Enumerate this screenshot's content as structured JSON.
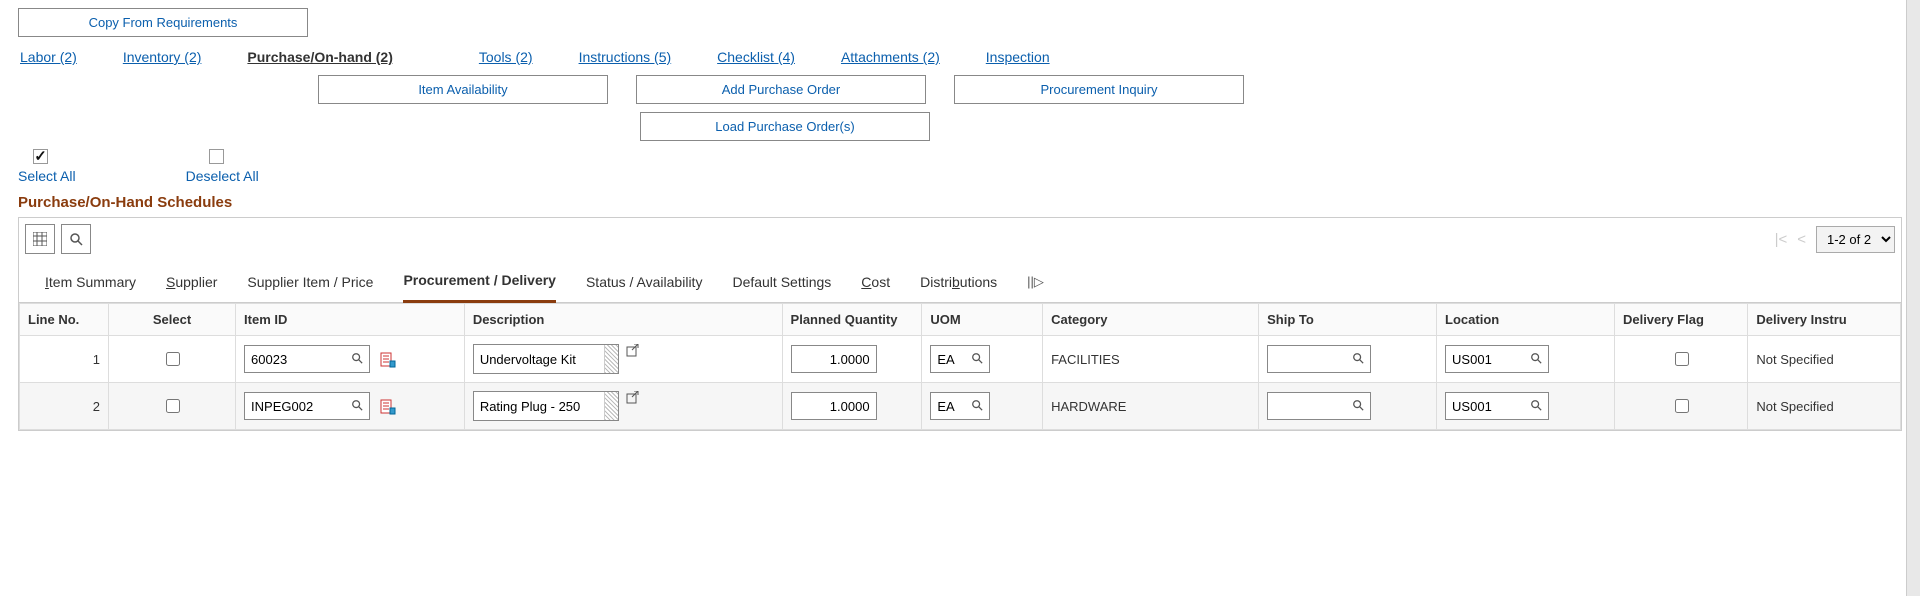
{
  "buttons": {
    "copy_from_requirements": "Copy From Requirements",
    "item_availability": "Item Availability",
    "add_purchase_order": "Add Purchase Order",
    "procurement_inquiry": "Procurement Inquiry",
    "load_purchase_orders": "Load Purchase Order(s)"
  },
  "tabs": [
    {
      "label": "Labor (2)"
    },
    {
      "label": "Inventory (2)"
    },
    {
      "label": "Purchase/On-hand (2)"
    },
    {
      "label": "Tools (2)"
    },
    {
      "label": "Instructions (5)"
    },
    {
      "label": "Checklist (4)"
    },
    {
      "label": "Attachments (2)"
    },
    {
      "label": "Inspection"
    }
  ],
  "select_all": "Select All",
  "deselect_all": "Deselect All",
  "section_title": "Purchase/On-Hand Schedules",
  "pager": {
    "range": "1-2 of 2"
  },
  "subtabs": {
    "item_summary": {
      "pre": "",
      "u": "I",
      "post": "tem Summary"
    },
    "supplier": {
      "pre": "",
      "u": "S",
      "post": "upplier"
    },
    "supplier_item_price": "Supplier Item / Price",
    "procurement_delivery": "Procurement / Delivery",
    "status_availability": "Status / Availability",
    "default_settings": "Default Settings",
    "cost": {
      "pre": "",
      "u": "C",
      "post": "ost"
    },
    "distributions": {
      "pre": "Distri",
      "u": "b",
      "post": "utions"
    }
  },
  "columns": {
    "line_no": "Line No.",
    "select": "Select",
    "item_id": "Item ID",
    "description": "Description",
    "planned_qty": "Planned Quantity",
    "uom": "UOM",
    "category": "Category",
    "ship_to": "Ship To",
    "location": "Location",
    "delivery_flag": "Delivery Flag",
    "delivery_instr": "Delivery Instru"
  },
  "rows": [
    {
      "line": "1",
      "item_id": "60023",
      "description": "Undervoltage Kit",
      "planned_qty": "1.0000",
      "uom": "EA",
      "category": "FACILITIES",
      "ship_to": "",
      "location": "US001",
      "delivery_instr": "Not Specified"
    },
    {
      "line": "2",
      "item_id": "INPEG002",
      "description": "Rating Plug - 250",
      "planned_qty": "1.0000",
      "uom": "EA",
      "category": "HARDWARE",
      "ship_to": "",
      "location": "US001",
      "delivery_instr": "Not Specified"
    }
  ]
}
